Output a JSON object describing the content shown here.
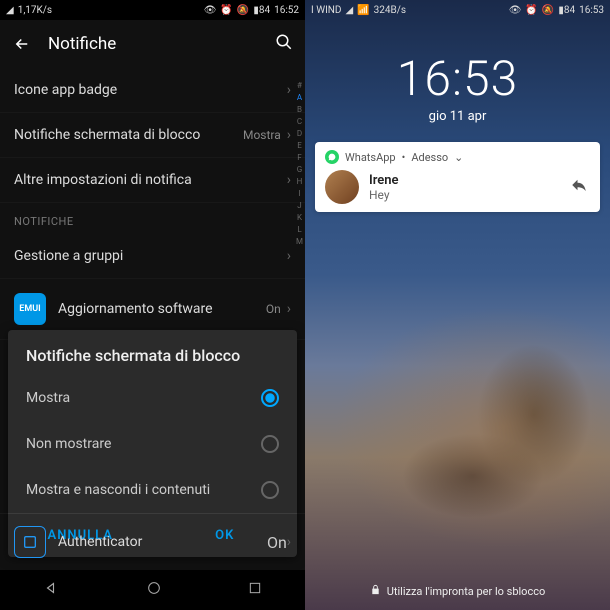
{
  "left": {
    "status": {
      "signal": "1,17K/s",
      "time": "16:52",
      "battery": "84"
    },
    "header": {
      "title": "Notifiche"
    },
    "rows": [
      {
        "label": "Icone app badge",
        "value": ""
      },
      {
        "label": "Notifiche schermata di blocco",
        "value": "Mostra"
      },
      {
        "label": "Altre impostazioni di notifica",
        "value": ""
      }
    ],
    "section": "NOTIFICHE",
    "group_row": {
      "label": "Gestione a gruppi",
      "value": ""
    },
    "emui_row": {
      "badge": "EMUI",
      "label": "Aggiornamento software",
      "value": "On"
    },
    "auth_row": {
      "label": "Authenticator",
      "value": "On"
    },
    "alpha": [
      "#",
      "A",
      "B",
      "C",
      "D",
      "E",
      "F",
      "G",
      "H",
      "I",
      "J",
      "K",
      "L",
      "M"
    ],
    "dialog": {
      "title": "Notifiche schermata di blocco",
      "options": [
        {
          "label": "Mostra",
          "selected": true
        },
        {
          "label": "Non mostrare",
          "selected": false
        },
        {
          "label": "Mostra e nascondi i contenuti",
          "selected": false
        }
      ],
      "cancel": "ANNULLA",
      "ok": "OK"
    }
  },
  "right": {
    "status": {
      "carrier": "I WIND",
      "net": "324B/s",
      "time": "16:53",
      "battery": "84"
    },
    "clock": {
      "time": "16:53",
      "date": "gio 11 apr"
    },
    "notif": {
      "app": "WhatsApp",
      "when": "Adesso",
      "sender": "Irene",
      "msg": "Hey"
    },
    "hint": "Utilizza l'impronta per lo sblocco"
  }
}
